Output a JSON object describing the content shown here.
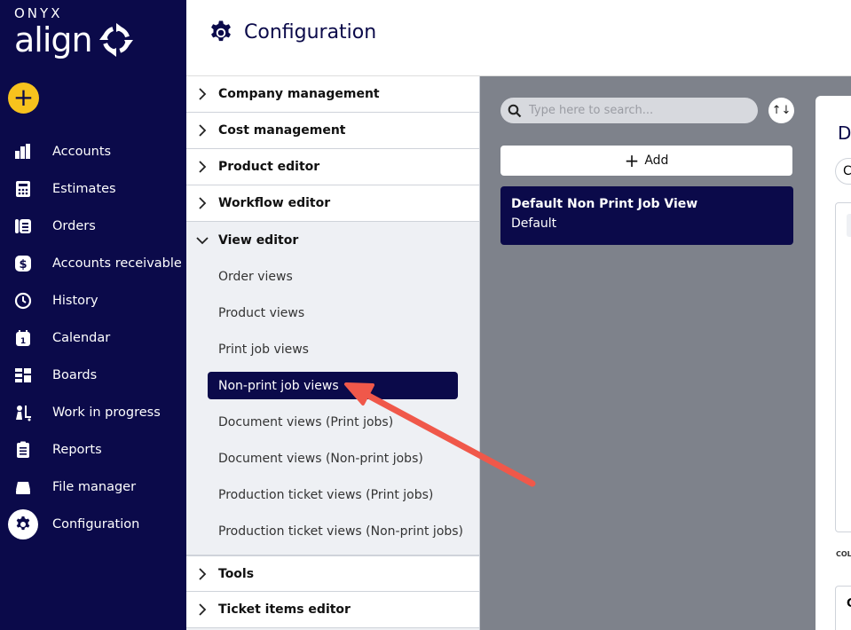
{
  "brand": {
    "top": "ONYX",
    "main": "align"
  },
  "sidebar": {
    "add_label": "+",
    "items": [
      {
        "label": "Accounts",
        "icon": "accounts-icon"
      },
      {
        "label": "Estimates",
        "icon": "estimates-icon"
      },
      {
        "label": "Orders",
        "icon": "orders-icon"
      },
      {
        "label": "Accounts receivable",
        "icon": "dollar-icon"
      },
      {
        "label": "History",
        "icon": "history-icon"
      },
      {
        "label": "Calendar",
        "icon": "calendar-icon"
      },
      {
        "label": "Boards",
        "icon": "boards-icon"
      },
      {
        "label": "Work in progress",
        "icon": "work-in-progress-icon"
      },
      {
        "label": "Reports",
        "icon": "reports-icon"
      },
      {
        "label": "File manager",
        "icon": "file-manager-icon"
      },
      {
        "label": "Configuration",
        "icon": "gear-icon"
      }
    ],
    "active": "Configuration"
  },
  "header": {
    "title": "Configuration"
  },
  "menu": {
    "sections_top": [
      {
        "label": "Company management"
      },
      {
        "label": "Cost management"
      },
      {
        "label": "Product editor"
      },
      {
        "label": "Workflow editor"
      }
    ],
    "expanded": {
      "label": "View editor",
      "items": [
        {
          "label": "Order views"
        },
        {
          "label": "Product views"
        },
        {
          "label": "Print job views"
        },
        {
          "label": "Non-print job views"
        },
        {
          "label": "Document views (Print jobs)"
        },
        {
          "label": "Document views (Non-print jobs)"
        },
        {
          "label": "Production ticket views (Print jobs)"
        },
        {
          "label": "Production ticket views (Non-print jobs)"
        }
      ],
      "active": "Non-print job views"
    },
    "sections_bottom": [
      {
        "label": "Tools"
      },
      {
        "label": "Ticket items editor"
      }
    ]
  },
  "middle": {
    "search_placeholder": "Type here to search...",
    "sort_label": "↑↓",
    "add_label": "Add",
    "cards": [
      {
        "title": "Default Non Print Job View",
        "subtitle": "Default"
      }
    ]
  },
  "right": {
    "title": "D",
    "pill": "C",
    "caption": "COL",
    "box2": "C"
  },
  "colors": {
    "navy": "#0b0a4a",
    "accent_yellow": "#f7c21d",
    "panel_gray": "#7e828b",
    "arrow_red": "#f0584a"
  }
}
